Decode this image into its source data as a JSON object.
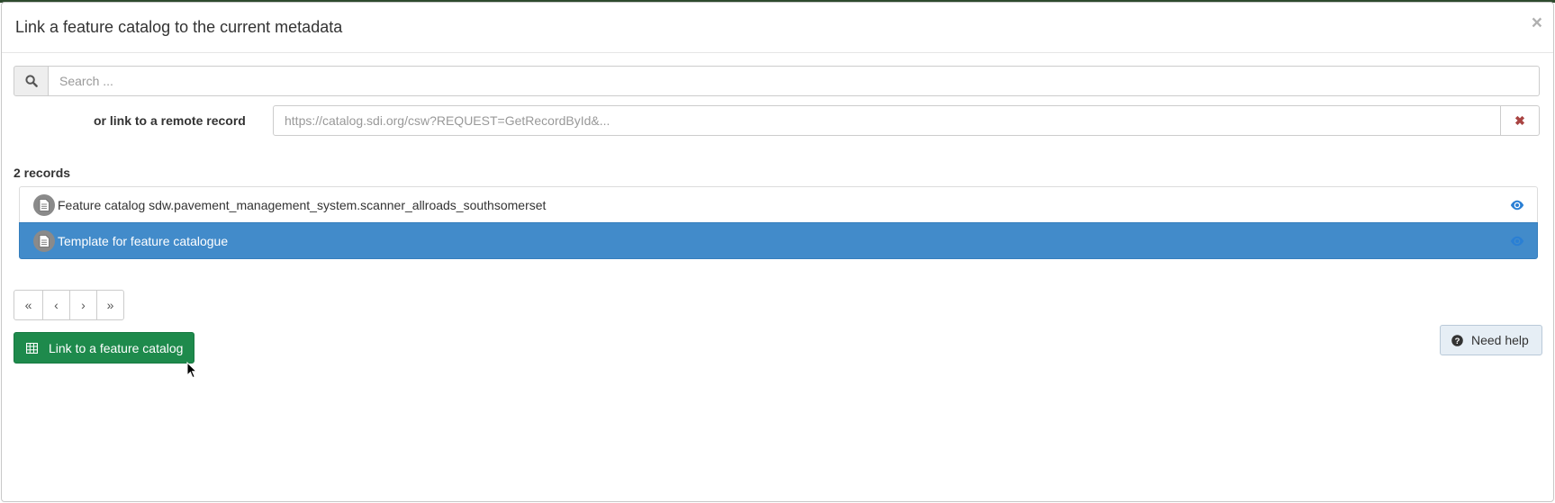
{
  "modal": {
    "title": "Link a feature catalog to the current metadata",
    "close_label": "×"
  },
  "search": {
    "placeholder": "Search ..."
  },
  "remote": {
    "label": "or link to a remote record",
    "placeholder": "https://catalog.sdi.org/csw?REQUEST=GetRecordById&...",
    "clear_label": "✖"
  },
  "results": {
    "count_label": "2 records",
    "items": [
      {
        "title": "Feature catalog sdw.pavement_management_system.scanner_allroads_southsomerset",
        "selected": false
      },
      {
        "title": "Template for feature catalogue",
        "selected": true
      }
    ]
  },
  "pager": {
    "first": "«",
    "prev": "‹",
    "next": "›",
    "last": "»"
  },
  "actions": {
    "link_label": "Link to a feature catalog",
    "help_label": "Need help"
  },
  "colors": {
    "selected_row": "#428bca",
    "primary_button": "#1e8a4c",
    "eye_icon": "#2a7fd4",
    "clear_icon": "#a94442"
  }
}
